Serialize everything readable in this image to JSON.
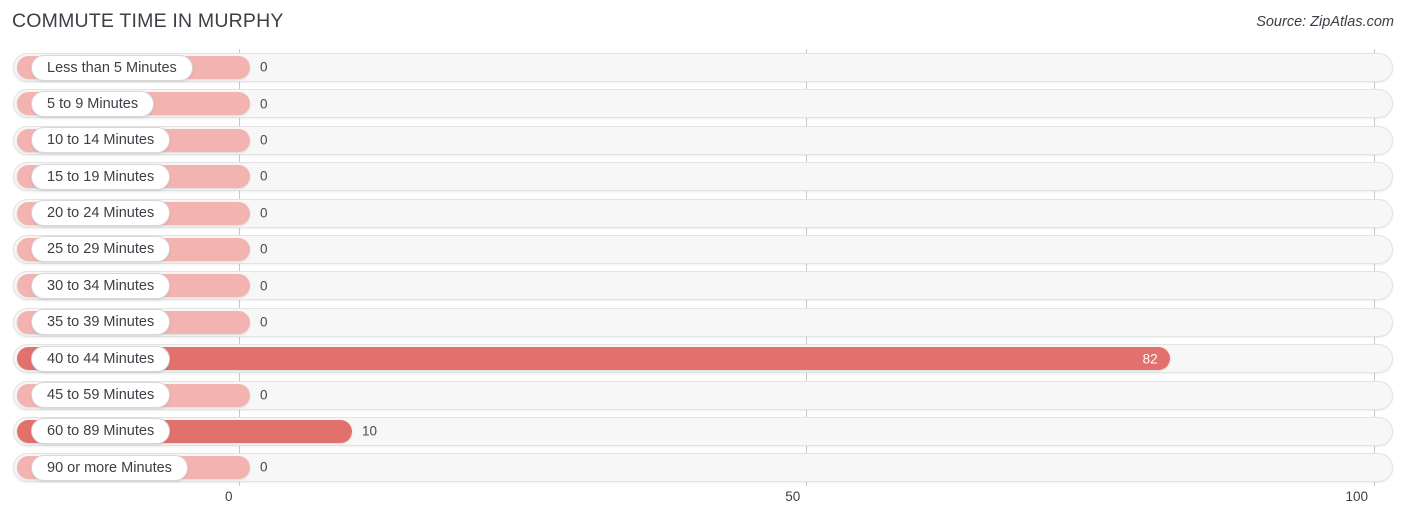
{
  "header": {
    "title": "COMMUTE TIME IN MURPHY",
    "source": "Source: ZipAtlas.com"
  },
  "colors": {
    "bar_zero": "#f3b3b0",
    "bar_active": "#e2706c",
    "track": "#f7f7f7",
    "gridline": "#c9c9c9",
    "text": "#3c3f45",
    "value_inside": "#ffffff",
    "value_outside": "#4a4a4a"
  },
  "chart_data": {
    "type": "bar",
    "orientation": "horizontal",
    "title": "COMMUTE TIME IN MURPHY",
    "xlabel": "",
    "ylabel": "",
    "xlim": [
      0,
      100
    ],
    "ticks": [
      0,
      50,
      100
    ],
    "tick_labels": [
      "0",
      "50",
      "100"
    ],
    "grid": true,
    "legend": false,
    "categories": [
      "Less than 5 Minutes",
      "5 to 9 Minutes",
      "10 to 14 Minutes",
      "15 to 19 Minutes",
      "20 to 24 Minutes",
      "25 to 29 Minutes",
      "30 to 34 Minutes",
      "35 to 39 Minutes",
      "40 to 44 Minutes",
      "45 to 59 Minutes",
      "60 to 89 Minutes",
      "90 or more Minutes"
    ],
    "values": [
      0,
      0,
      0,
      0,
      0,
      0,
      0,
      0,
      82,
      0,
      10,
      0
    ],
    "value_labels": [
      "0",
      "0",
      "0",
      "0",
      "0",
      "0",
      "0",
      "0",
      "82",
      "0",
      "10",
      "0"
    ]
  },
  "rows": [
    {
      "label": "Less than 5 Minutes",
      "value": 0,
      "value_label": "0"
    },
    {
      "label": "5 to 9 Minutes",
      "value": 0,
      "value_label": "0"
    },
    {
      "label": "10 to 14 Minutes",
      "value": 0,
      "value_label": "0"
    },
    {
      "label": "15 to 19 Minutes",
      "value": 0,
      "value_label": "0"
    },
    {
      "label": "20 to 24 Minutes",
      "value": 0,
      "value_label": "0"
    },
    {
      "label": "25 to 29 Minutes",
      "value": 0,
      "value_label": "0"
    },
    {
      "label": "30 to 34 Minutes",
      "value": 0,
      "value_label": "0"
    },
    {
      "label": "35 to 39 Minutes",
      "value": 0,
      "value_label": "0"
    },
    {
      "label": "40 to 44 Minutes",
      "value": 82,
      "value_label": "82"
    },
    {
      "label": "45 to 59 Minutes",
      "value": 0,
      "value_label": "0"
    },
    {
      "label": "60 to 89 Minutes",
      "value": 10,
      "value_label": "10"
    },
    {
      "label": "90 or more Minutes",
      "value": 0,
      "value_label": "0"
    }
  ],
  "axis": {
    "ticks": [
      "0",
      "50",
      "100"
    ]
  }
}
